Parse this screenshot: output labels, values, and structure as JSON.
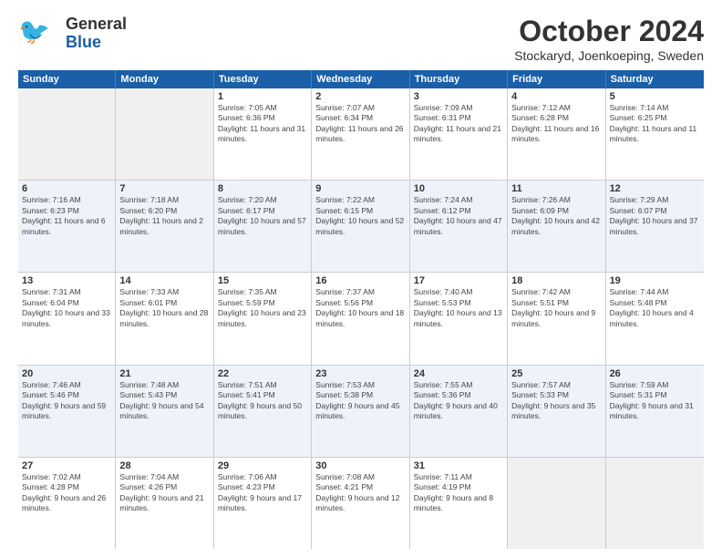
{
  "header": {
    "logo_general": "General",
    "logo_blue": "Blue",
    "month": "October 2024",
    "location": "Stockaryd, Joenkoeping, Sweden"
  },
  "weekdays": [
    "Sunday",
    "Monday",
    "Tuesday",
    "Wednesday",
    "Thursday",
    "Friday",
    "Saturday"
  ],
  "weeks": [
    [
      {
        "day": "",
        "empty": true
      },
      {
        "day": "",
        "empty": true
      },
      {
        "day": "1",
        "sunrise": "Sunrise: 7:05 AM",
        "sunset": "Sunset: 6:36 PM",
        "daylight": "Daylight: 11 hours and 31 minutes."
      },
      {
        "day": "2",
        "sunrise": "Sunrise: 7:07 AM",
        "sunset": "Sunset: 6:34 PM",
        "daylight": "Daylight: 11 hours and 26 minutes."
      },
      {
        "day": "3",
        "sunrise": "Sunrise: 7:09 AM",
        "sunset": "Sunset: 6:31 PM",
        "daylight": "Daylight: 11 hours and 21 minutes."
      },
      {
        "day": "4",
        "sunrise": "Sunrise: 7:12 AM",
        "sunset": "Sunset: 6:28 PM",
        "daylight": "Daylight: 11 hours and 16 minutes."
      },
      {
        "day": "5",
        "sunrise": "Sunrise: 7:14 AM",
        "sunset": "Sunset: 6:25 PM",
        "daylight": "Daylight: 11 hours and 11 minutes."
      }
    ],
    [
      {
        "day": "6",
        "sunrise": "Sunrise: 7:16 AM",
        "sunset": "Sunset: 6:23 PM",
        "daylight": "Daylight: 11 hours and 6 minutes."
      },
      {
        "day": "7",
        "sunrise": "Sunrise: 7:18 AM",
        "sunset": "Sunset: 6:20 PM",
        "daylight": "Daylight: 11 hours and 2 minutes."
      },
      {
        "day": "8",
        "sunrise": "Sunrise: 7:20 AM",
        "sunset": "Sunset: 6:17 PM",
        "daylight": "Daylight: 10 hours and 57 minutes."
      },
      {
        "day": "9",
        "sunrise": "Sunrise: 7:22 AM",
        "sunset": "Sunset: 6:15 PM",
        "daylight": "Daylight: 10 hours and 52 minutes."
      },
      {
        "day": "10",
        "sunrise": "Sunrise: 7:24 AM",
        "sunset": "Sunset: 6:12 PM",
        "daylight": "Daylight: 10 hours and 47 minutes."
      },
      {
        "day": "11",
        "sunrise": "Sunrise: 7:26 AM",
        "sunset": "Sunset: 6:09 PM",
        "daylight": "Daylight: 10 hours and 42 minutes."
      },
      {
        "day": "12",
        "sunrise": "Sunrise: 7:29 AM",
        "sunset": "Sunset: 6:07 PM",
        "daylight": "Daylight: 10 hours and 37 minutes."
      }
    ],
    [
      {
        "day": "13",
        "sunrise": "Sunrise: 7:31 AM",
        "sunset": "Sunset: 6:04 PM",
        "daylight": "Daylight: 10 hours and 33 minutes."
      },
      {
        "day": "14",
        "sunrise": "Sunrise: 7:33 AM",
        "sunset": "Sunset: 6:01 PM",
        "daylight": "Daylight: 10 hours and 28 minutes."
      },
      {
        "day": "15",
        "sunrise": "Sunrise: 7:35 AM",
        "sunset": "Sunset: 5:59 PM",
        "daylight": "Daylight: 10 hours and 23 minutes."
      },
      {
        "day": "16",
        "sunrise": "Sunrise: 7:37 AM",
        "sunset": "Sunset: 5:56 PM",
        "daylight": "Daylight: 10 hours and 18 minutes."
      },
      {
        "day": "17",
        "sunrise": "Sunrise: 7:40 AM",
        "sunset": "Sunset: 5:53 PM",
        "daylight": "Daylight: 10 hours and 13 minutes."
      },
      {
        "day": "18",
        "sunrise": "Sunrise: 7:42 AM",
        "sunset": "Sunset: 5:51 PM",
        "daylight": "Daylight: 10 hours and 9 minutes."
      },
      {
        "day": "19",
        "sunrise": "Sunrise: 7:44 AM",
        "sunset": "Sunset: 5:48 PM",
        "daylight": "Daylight: 10 hours and 4 minutes."
      }
    ],
    [
      {
        "day": "20",
        "sunrise": "Sunrise: 7:46 AM",
        "sunset": "Sunset: 5:46 PM",
        "daylight": "Daylight: 9 hours and 59 minutes."
      },
      {
        "day": "21",
        "sunrise": "Sunrise: 7:48 AM",
        "sunset": "Sunset: 5:43 PM",
        "daylight": "Daylight: 9 hours and 54 minutes."
      },
      {
        "day": "22",
        "sunrise": "Sunrise: 7:51 AM",
        "sunset": "Sunset: 5:41 PM",
        "daylight": "Daylight: 9 hours and 50 minutes."
      },
      {
        "day": "23",
        "sunrise": "Sunrise: 7:53 AM",
        "sunset": "Sunset: 5:38 PM",
        "daylight": "Daylight: 9 hours and 45 minutes."
      },
      {
        "day": "24",
        "sunrise": "Sunrise: 7:55 AM",
        "sunset": "Sunset: 5:36 PM",
        "daylight": "Daylight: 9 hours and 40 minutes."
      },
      {
        "day": "25",
        "sunrise": "Sunrise: 7:57 AM",
        "sunset": "Sunset: 5:33 PM",
        "daylight": "Daylight: 9 hours and 35 minutes."
      },
      {
        "day": "26",
        "sunrise": "Sunrise: 7:59 AM",
        "sunset": "Sunset: 5:31 PM",
        "daylight": "Daylight: 9 hours and 31 minutes."
      }
    ],
    [
      {
        "day": "27",
        "sunrise": "Sunrise: 7:02 AM",
        "sunset": "Sunset: 4:28 PM",
        "daylight": "Daylight: 9 hours and 26 minutes."
      },
      {
        "day": "28",
        "sunrise": "Sunrise: 7:04 AM",
        "sunset": "Sunset: 4:26 PM",
        "daylight": "Daylight: 9 hours and 21 minutes."
      },
      {
        "day": "29",
        "sunrise": "Sunrise: 7:06 AM",
        "sunset": "Sunset: 4:23 PM",
        "daylight": "Daylight: 9 hours and 17 minutes."
      },
      {
        "day": "30",
        "sunrise": "Sunrise: 7:08 AM",
        "sunset": "Sunset: 4:21 PM",
        "daylight": "Daylight: 9 hours and 12 minutes."
      },
      {
        "day": "31",
        "sunrise": "Sunrise: 7:11 AM",
        "sunset": "Sunset: 4:19 PM",
        "daylight": "Daylight: 9 hours and 8 minutes."
      },
      {
        "day": "",
        "empty": true
      },
      {
        "day": "",
        "empty": true
      }
    ]
  ]
}
